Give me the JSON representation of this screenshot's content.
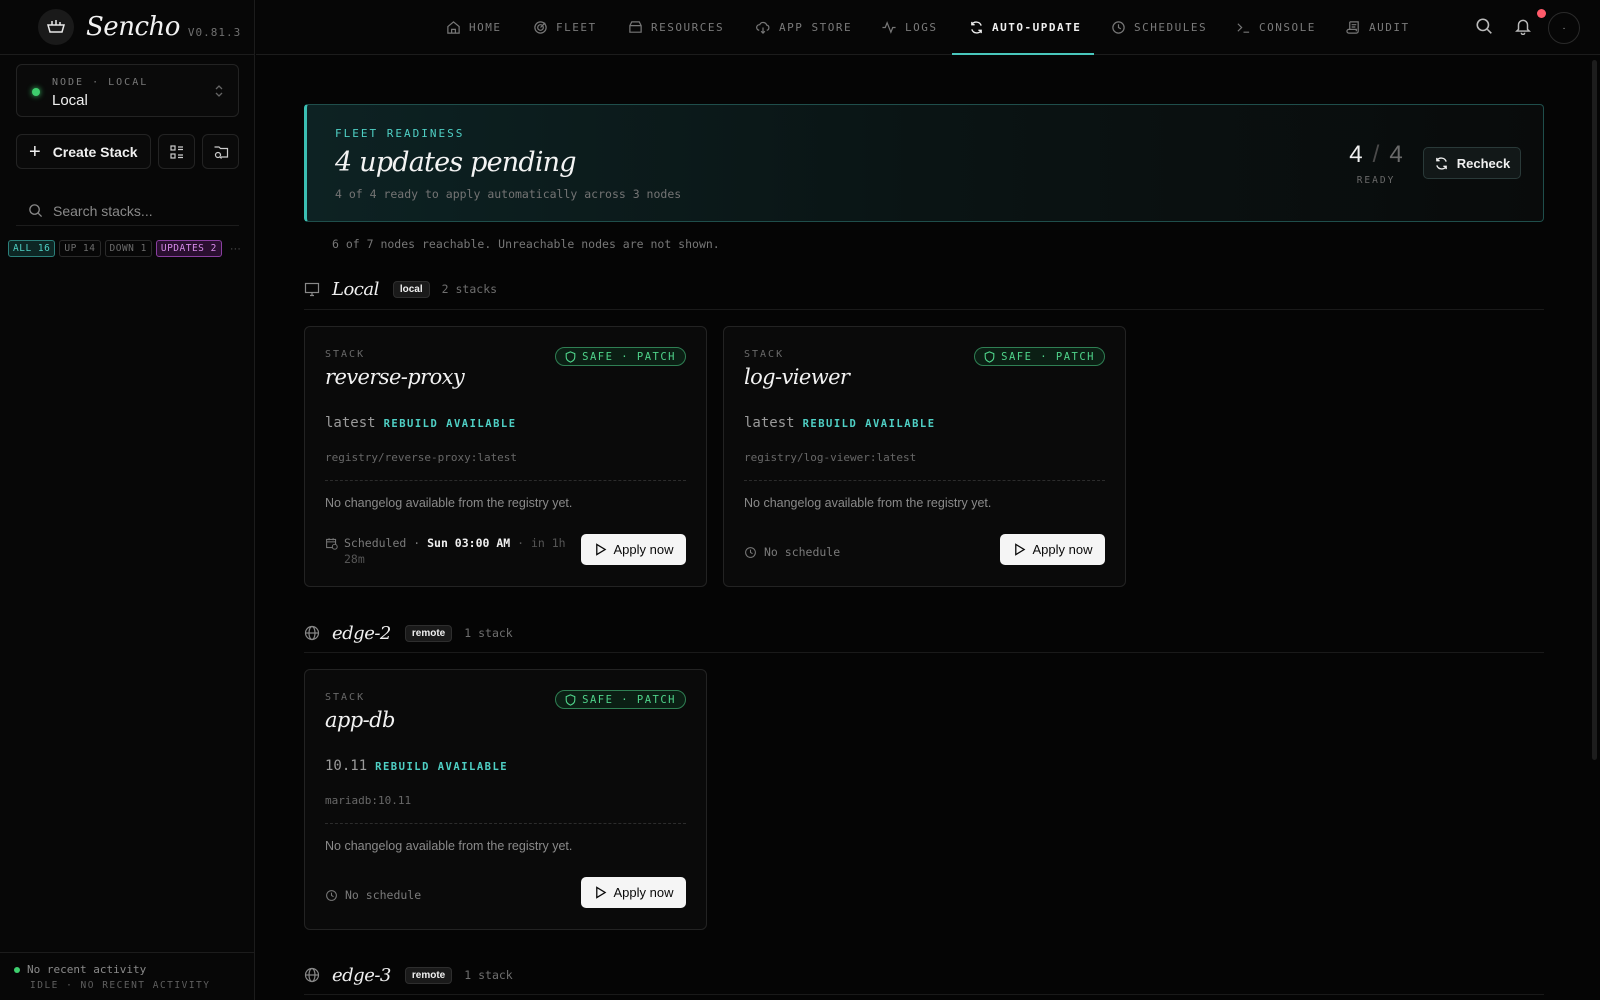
{
  "app": {
    "name": "Sencho",
    "version": "V0.81.3"
  },
  "sidebar": {
    "node": {
      "kicker": "NODE · LOCAL",
      "name": "Local",
      "status_color": "#3ecf6e"
    },
    "create_label": "Create Stack",
    "search_placeholder": "Search stacks...",
    "filters": [
      {
        "label": "ALL",
        "count": "16"
      },
      {
        "label": "UP",
        "count": "14"
      },
      {
        "label": "DOWN",
        "count": "1"
      },
      {
        "label": "UPDATES",
        "count": "2"
      }
    ],
    "more_label": "···",
    "activity": {
      "line1": "No recent activity",
      "line2": "IDLE · NO RECENT ACTIVITY"
    }
  },
  "nav": {
    "items": [
      "HOME",
      "FLEET",
      "RESOURCES",
      "APP STORE",
      "LOGS",
      "AUTO-UPDATE",
      "SCHEDULES",
      "CONSOLE",
      "AUDIT"
    ],
    "active": "AUTO-UPDATE",
    "accent": "#49c7bd",
    "avatar": "·"
  },
  "hero": {
    "kicker": "FLEET READINESS",
    "title": "4 updates pending",
    "subtitle": "4 of 4 ready to apply automatically across 3 nodes",
    "ready": "4",
    "total": "4",
    "ready_label": "READY",
    "recheck_label": "Recheck"
  },
  "reach_note": "6 of 7 nodes reachable. Unreachable nodes are not shown.",
  "groups": [
    {
      "name": "Local",
      "tag": "local",
      "count": "2 stacks"
    },
    {
      "name": "edge-2",
      "tag": "remote",
      "count": "1 stack"
    },
    {
      "name": "edge-3",
      "tag": "remote",
      "count": "1 stack"
    }
  ],
  "cards": [
    {
      "kicker": "STACK",
      "name": "reverse-proxy",
      "badge": "SAFE · PATCH",
      "version": "latest",
      "availability": "REBUILD AVAILABLE",
      "image": "registry/reverse-proxy:latest",
      "changelog": "No changelog available from the registry yet.",
      "schedule_prefix": "Scheduled ·",
      "schedule_time": "Sun 03:00 AM",
      "schedule_rel": "· in 1h 28m",
      "apply_label": "Apply now"
    },
    {
      "kicker": "STACK",
      "name": "log-viewer",
      "badge": "SAFE · PATCH",
      "version": "latest",
      "availability": "REBUILD AVAILABLE",
      "image": "registry/log-viewer:latest",
      "changelog": "No changelog available from the registry yet.",
      "schedule_none": "No schedule",
      "apply_label": "Apply now"
    },
    {
      "kicker": "STACK",
      "name": "app-db",
      "badge": "SAFE · PATCH",
      "version": "10.11",
      "availability": "REBUILD AVAILABLE",
      "image": "mariadb:10.11",
      "changelog": "No changelog available from the registry yet.",
      "schedule_none": "No schedule",
      "apply_label": "Apply now"
    }
  ]
}
